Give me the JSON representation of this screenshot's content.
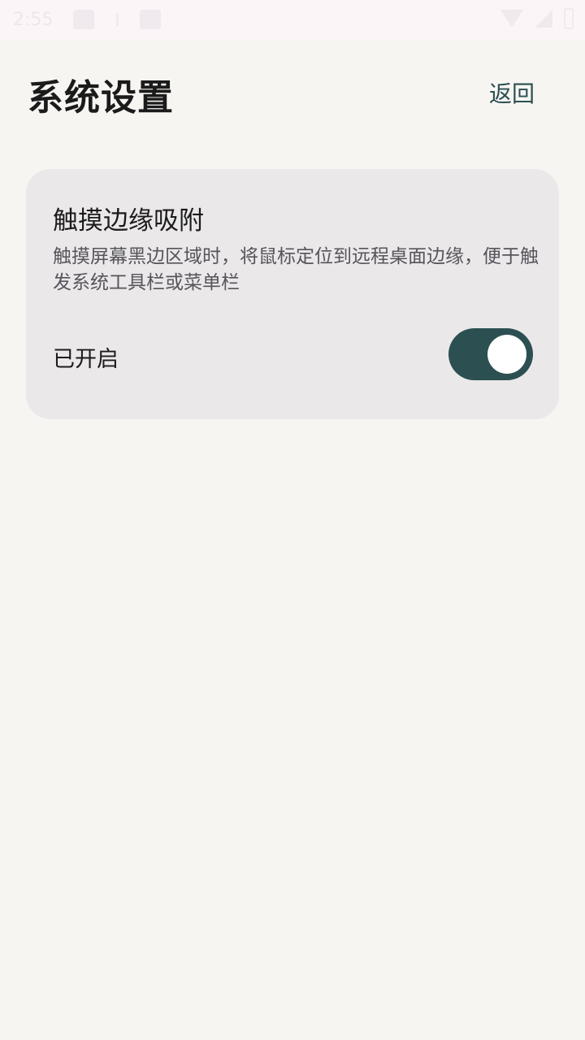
{
  "status_bar": {
    "time": "2:55"
  },
  "header": {
    "title": "系统设置",
    "back_label": "返回"
  },
  "setting": {
    "title": "触摸边缘吸附",
    "description": "触摸屏幕黑边区域时，将鼠标定位到远程桌面边缘，便于触发系统工具栏或菜单栏",
    "status_text": "已开启",
    "enabled": true
  },
  "colors": {
    "accent": "#2c5052",
    "background": "#f7f5f2",
    "card": "#ebe8ea"
  },
  "icons": [
    "image-icon",
    "download-icon",
    "image-icon",
    "wifi-icon",
    "signal-icon",
    "battery-icon"
  ]
}
